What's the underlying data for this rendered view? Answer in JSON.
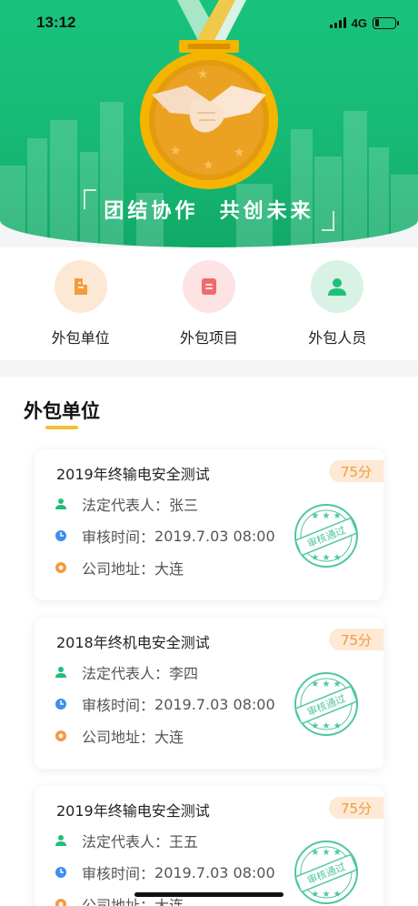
{
  "status_bar": {
    "time": "13:12",
    "network": "4G"
  },
  "hero": {
    "slogan": "团结协作  共创未来",
    "accent": "#19c37d"
  },
  "quick_links": [
    {
      "label": "外包单位",
      "icon": "building-icon",
      "color": "#f59a3d",
      "bg": "#fde8d5"
    },
    {
      "label": "外包项目",
      "icon": "document-icon",
      "color": "#ef6b6b",
      "bg": "#fde3e3"
    },
    {
      "label": "外包人员",
      "icon": "person-icon",
      "color": "#1fbf7a",
      "bg": "#d8f3e6"
    }
  ],
  "section": {
    "title": "外包单位"
  },
  "labels": {
    "representative": "法定代表人：",
    "review_time": "审核时间：",
    "address": "公司地址：",
    "stamp": "审核通过"
  },
  "cards": [
    {
      "title": "2019年终输电安全测试",
      "score": "75分",
      "representative": "张三",
      "review_time": "2019.7.03 08:00",
      "address": "大连"
    },
    {
      "title": "2018年终机电安全测试",
      "score": "75分",
      "representative": "李四",
      "review_time": "2019.7.03 08:00",
      "address": "大连"
    },
    {
      "title": "2019年终输电安全测试",
      "score": "75分",
      "representative": "王五",
      "review_time": "2019.7.03 08:00",
      "address": "大连"
    }
  ]
}
